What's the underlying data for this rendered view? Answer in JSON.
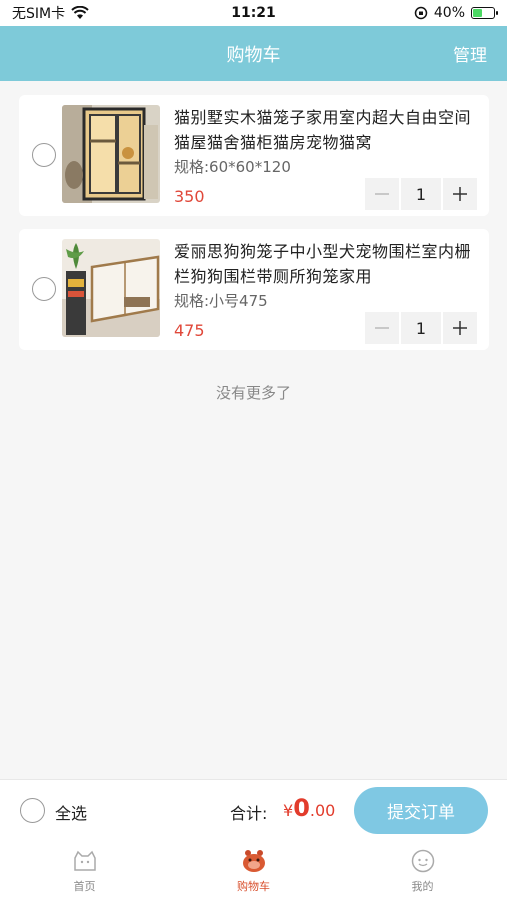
{
  "status_bar": {
    "carrier": "无SIM卡",
    "time": "11:21",
    "battery": "40%"
  },
  "nav": {
    "title": "购物车",
    "manage": "管理"
  },
  "items": [
    {
      "title": "猫别墅实木猫笼子家用室内超大自由空间猫屋猫舍猫柜猫房宠物猫窝",
      "spec": "规格:60*60*120",
      "price": "350",
      "qty": "1"
    },
    {
      "title": "爱丽思狗狗笼子中小型犬宠物围栏室内栅栏狗狗围栏带厕所狗笼家用",
      "spec": "规格:小号475",
      "price": "475",
      "qty": "1"
    }
  ],
  "no_more": "没有更多了",
  "checkout": {
    "select_all": "全选",
    "total_label": "合计:",
    "currency": "¥",
    "amount_int": "0",
    "amount_dec": ".00",
    "submit": "提交订单"
  },
  "tabs": [
    {
      "label": "首页",
      "icon": "home-icon"
    },
    {
      "label": "购物车",
      "icon": "cart-icon"
    },
    {
      "label": "我的",
      "icon": "profile-icon"
    }
  ],
  "colors": {
    "header": "#7ecad9",
    "price": "#e0483a",
    "submit": "#7fc8e3",
    "active_tab": "#d84f2d"
  }
}
